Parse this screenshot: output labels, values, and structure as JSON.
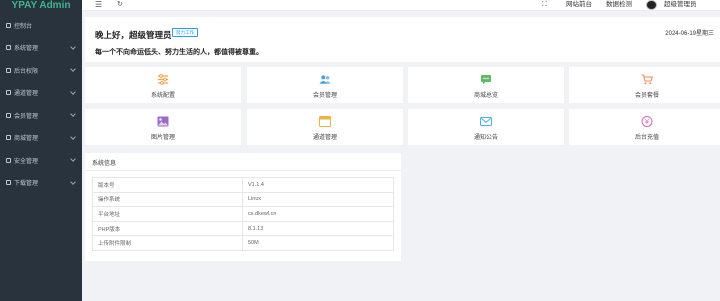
{
  "app": {
    "title": "YPAY Admin"
  },
  "sidebar": {
    "items": [
      {
        "label": "控制台",
        "has_children": false
      },
      {
        "label": "系统管理",
        "has_children": true
      },
      {
        "label": "后台权限",
        "has_children": true
      },
      {
        "label": "通道管理",
        "has_children": true
      },
      {
        "label": "会员管理",
        "has_children": true
      },
      {
        "label": "商城管理",
        "has_children": true
      },
      {
        "label": "安全管理",
        "has_children": true
      },
      {
        "label": "下载管理",
        "has_children": true
      }
    ]
  },
  "topbar": {
    "menu_icon": "hamburger-icon",
    "refresh_icon": "refresh-icon",
    "fullscreen_icon": "fullscreen-icon",
    "links": [
      "网站前台",
      "数据检测"
    ],
    "user": "超级管理员"
  },
  "welcome": {
    "greeting": "晚上好，超级管理员",
    "badge": "努力工作",
    "motto": "每一个不向命运低头、努力生活的人，都值得被尊重。",
    "datetime": "2024-06-19星期三"
  },
  "shortcuts": [
    {
      "label": "系统配置",
      "icon": "settings-sliders-icon",
      "color": "#f5a04a"
    },
    {
      "label": "会员管理",
      "icon": "users-icon",
      "color": "#4b9fd9"
    },
    {
      "label": "商城总览",
      "icon": "chat-screen-icon",
      "color": "#5dbb63"
    },
    {
      "label": "会员套餐",
      "icon": "cart-icon",
      "color": "#f08a5d"
    },
    {
      "label": "图片管理",
      "icon": "image-icon",
      "color": "#9b6bc8"
    },
    {
      "label": "通道管理",
      "icon": "window-icon",
      "color": "#f2b33d"
    },
    {
      "label": "通知公告",
      "icon": "mail-icon",
      "color": "#4cb3e6"
    },
    {
      "label": "后台充值",
      "icon": "yen-icon",
      "color": "#d46bc0"
    }
  ],
  "system_info": {
    "title": "系统信息",
    "rows": [
      {
        "key": "版本号",
        "value": "V1.1.4"
      },
      {
        "key": "操作系统",
        "value": "Linux"
      },
      {
        "key": "平台地址",
        "value": "cs.dkewl.cn"
      },
      {
        "key": "PHP版本",
        "value": "8.1.13"
      },
      {
        "key": "上传附件限制",
        "value": "50M"
      }
    ]
  }
}
